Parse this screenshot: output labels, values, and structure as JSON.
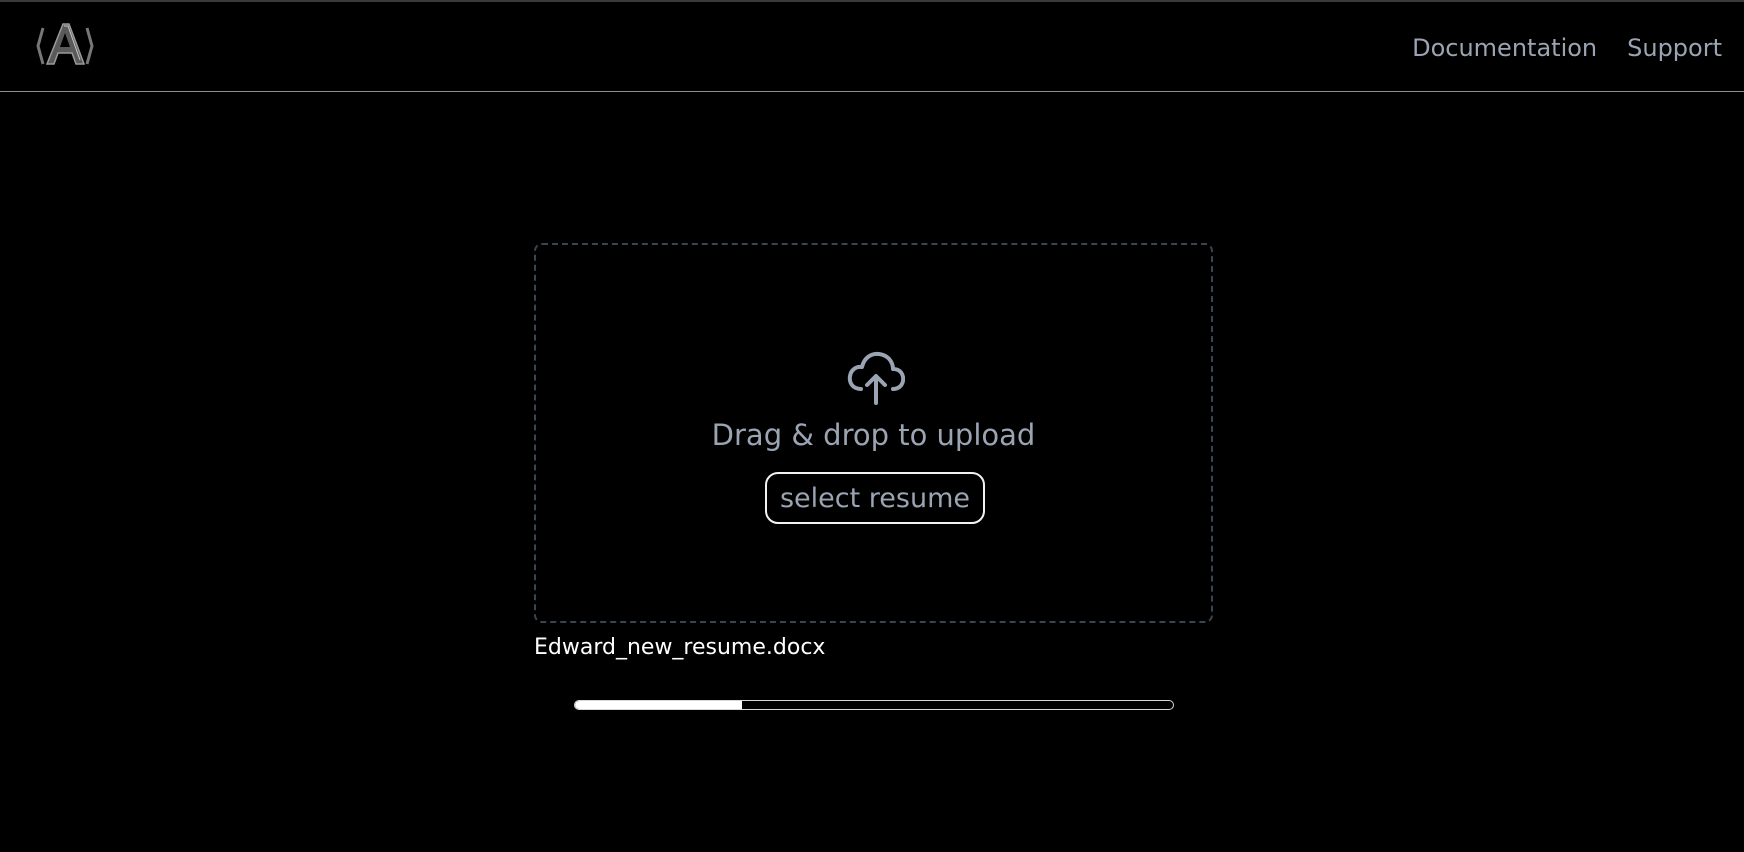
{
  "header": {
    "nav": [
      {
        "label": "Documentation"
      },
      {
        "label": "Support"
      }
    ],
    "logo_icon": "app-logo-a"
  },
  "upload": {
    "icon": "cloud-upload-icon",
    "drop_text": "Drag & drop to upload",
    "select_label": "select resume"
  },
  "file": {
    "name": "Edward_new_resume.docx",
    "progress_fraction": 0.28
  },
  "colors": {
    "background": "#000000",
    "muted_text": "#9aa4b2",
    "dropzone_border": "#3b4451",
    "progress_fill": "#ffffff"
  }
}
